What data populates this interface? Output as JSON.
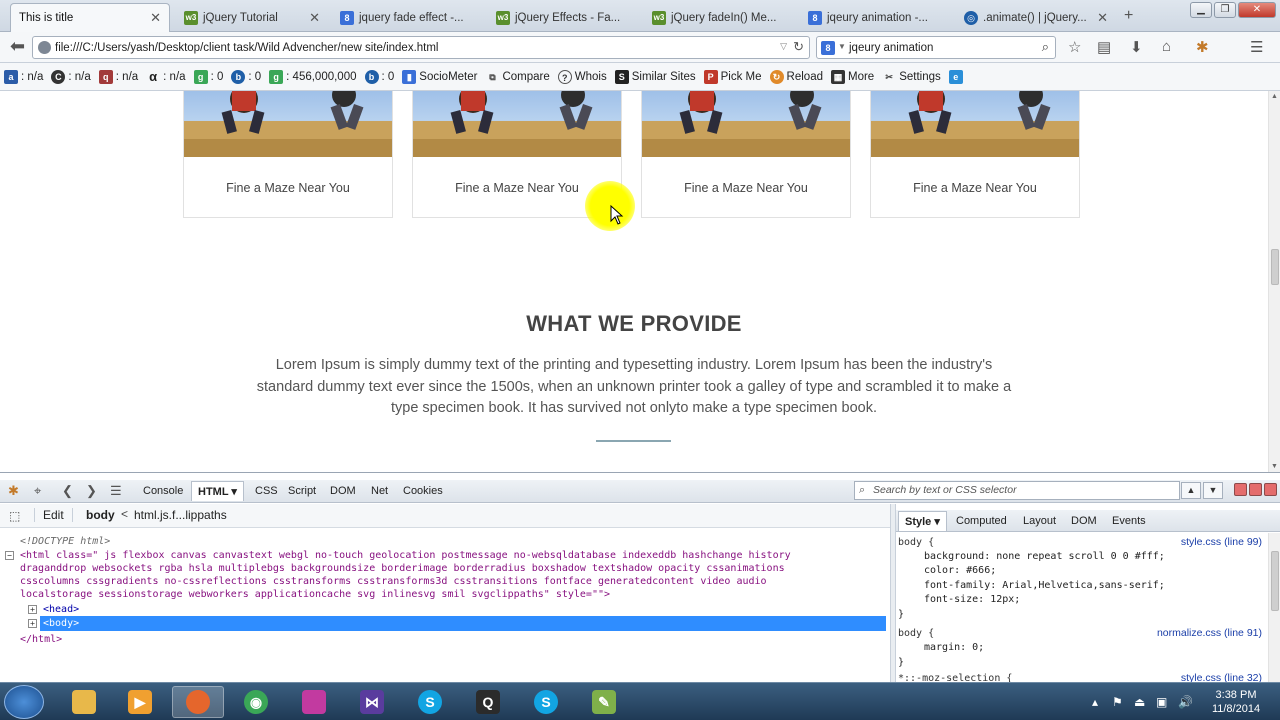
{
  "browser": {
    "tabs": [
      {
        "label": "This is title",
        "icon": "blank-page-icon",
        "active": true
      },
      {
        "label": "jQuery Tutorial",
        "icon": "w3schools-icon"
      },
      {
        "label": "jquery fade effect -...",
        "icon": "google-icon"
      },
      {
        "label": "jQuery Effects - Fa...",
        "icon": "w3schools-icon"
      },
      {
        "label": "jQuery fadeIn() Me...",
        "icon": "w3schools-icon"
      },
      {
        "label": "jqeury animation -...",
        "icon": "google-icon"
      },
      {
        "label": ".animate() | jQuery...",
        "icon": "jquery-icon"
      }
    ],
    "url": "file:///C:/Users/yash/Desktop/client task/Wild Advencher/new site/index.html",
    "search_value": "jqeury animation",
    "bookmarks": [
      {
        "label": ": n/a",
        "icon": "alexa-icon"
      },
      {
        "label": ": n/a",
        "icon": "compete-icon"
      },
      {
        "label": ": n/a",
        "icon": "quantcast-icon"
      },
      {
        "label": ": n/a",
        "icon": "alpha-icon"
      },
      {
        "label": ": 0",
        "icon": "google-index-icon"
      },
      {
        "label": ": 0",
        "icon": "bing-icon"
      },
      {
        "label": ": 456,000,000",
        "icon": "google-results-icon"
      },
      {
        "label": ": 0",
        "icon": "bing-results-icon"
      },
      {
        "label": "SocioMeter",
        "icon": "sociometer-icon"
      },
      {
        "label": "Compare",
        "icon": "compare-icon"
      },
      {
        "label": "Whois",
        "icon": "whois-icon"
      },
      {
        "label": "Similar Sites",
        "icon": "similar-sites-icon"
      },
      {
        "label": "Pick Me",
        "icon": "pick-me-icon"
      },
      {
        "label": "Reload",
        "icon": "reload-icon"
      },
      {
        "label": "More",
        "icon": "more-icon"
      },
      {
        "label": "Settings",
        "icon": "settings-icon"
      }
    ]
  },
  "page": {
    "cards": [
      {
        "caption": "Fine a Maze Near You"
      },
      {
        "caption": "Fine a Maze Near You"
      },
      {
        "caption": "Fine a Maze Near You"
      },
      {
        "caption": "Fine a Maze Near You"
      }
    ],
    "provide_title": "WHAT WE PROVIDE",
    "provide_text": "Lorem Ipsum is simply dummy text of the printing and typesetting industry. Lorem Ipsum has been the industry's standard dummy text ever since the 1500s, when an unknown printer took a galley of type and scrambled it to make a type specimen book. It has survived not onlyto make a type specimen book."
  },
  "firebug": {
    "tabs": [
      "Console",
      "HTML",
      "CSS",
      "Script",
      "DOM",
      "Net",
      "Cookies"
    ],
    "active_tab": "HTML",
    "search_placeholder": "Search by text or CSS selector",
    "edit_label": "Edit",
    "crumb_current": "body",
    "crumb_sep": "<",
    "crumb_parent": "html.js.f...lippaths",
    "html_tree": {
      "doctype": "<!DOCTYPE html>",
      "html_open_line1": "<html class=\" js flexbox canvas canvastext webgl no-touch geolocation postmessage no-websqldatabase indexeddb hashchange history",
      "html_open_line2": "draganddrop websockets rgba hsla multiplebgs backgroundsize borderimage borderradius boxshadow textshadow opacity cssanimations",
      "html_open_line3": "csscolumns cssgradients no-cssreflections csstransforms csstransforms3d csstransitions fontface generatedcontent video audio",
      "html_open_line4": "localstorage sessionstorage webworkers applicationcache svg inlinesvg smil svgclippaths\" style=\"\">",
      "head": "<head>",
      "body": "<body>",
      "html_close": "</html>"
    },
    "side_tabs": [
      "Style",
      "Computed",
      "Layout",
      "DOM",
      "Events"
    ],
    "active_side_tab": "Style",
    "style_rules": [
      {
        "selector": "body {",
        "source": "style.css (line 99)",
        "props": [
          "background: none repeat scroll 0 0 #fff;",
          "color: #666;",
          "font-family: Arial,Helvetica,sans-serif;",
          "font-size: 12px;"
        ]
      },
      {
        "selector": "body {",
        "source": "normalize.css (line 91)",
        "props": [
          "margin: 0;"
        ]
      },
      {
        "selector": "*::-moz-selection {",
        "source": "style.css (line 32)",
        "props": []
      }
    ]
  },
  "taskbar": {
    "apps": [
      {
        "name": "explorer-icon",
        "label": "",
        "color": "#e8b84a"
      },
      {
        "name": "media-player-icon",
        "label": "",
        "color": "#f0a030"
      },
      {
        "name": "firefox-icon",
        "label": "",
        "color": "#e5662c"
      },
      {
        "name": "chrome-icon",
        "label": "",
        "color": "#3aa757"
      },
      {
        "name": "paint-icon",
        "label": "",
        "color": "#c23aa0"
      },
      {
        "name": "visual-studio-icon",
        "label": "",
        "color": "#5a3c9e"
      },
      {
        "name": "skype-icon",
        "label": "S",
        "color": "#12a5e3"
      },
      {
        "name": "q-app-icon",
        "label": "Q",
        "color": "#2b2b2b"
      },
      {
        "name": "skype-icon-2",
        "label": "S",
        "color": "#12a5e3"
      },
      {
        "name": "notepad-icon",
        "label": "",
        "color": "#7fb04a"
      }
    ],
    "time": "3:38 PM",
    "date": "11/8/2014"
  }
}
